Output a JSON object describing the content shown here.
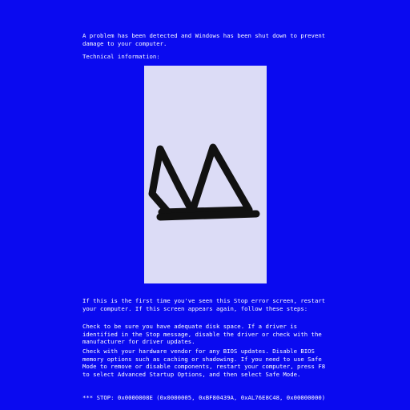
{
  "bsod": {
    "intro": "A problem has been detected and Windows has been shut down to prevent damage to your computer.",
    "technical_info_label": "Technical information:",
    "first_time_text": "If this is the first time you've seen this Stop error screen, restart your computer. If this screen appears again, follow these steps:",
    "disk_space_text": "Check to be sure you have adequate disk space. If a driver is identified in the Stop message, disable the driver or check with the manufacturer for driver updates.",
    "hardware_text": "Check with your hardware vendor for any BIOS updates. Disable BIOS memory options such as caching or shadowing. If you need to use Safe Mode to remove or disable components, restart your computer, press F8 to select Advanced Startup Options, and then select Safe Mode.",
    "stop_code": "*** STOP: 0x0000008E (0x0000005, 0xBF80439A, 0xAL76E8C48, 0x00000000)"
  },
  "colors": {
    "background": "#0a0af0",
    "text": "#ffffff",
    "panel": "#dcdcf6",
    "sketch": "#111111"
  },
  "icons": {
    "center_image": "hand-drawn-mountain-sketch"
  }
}
